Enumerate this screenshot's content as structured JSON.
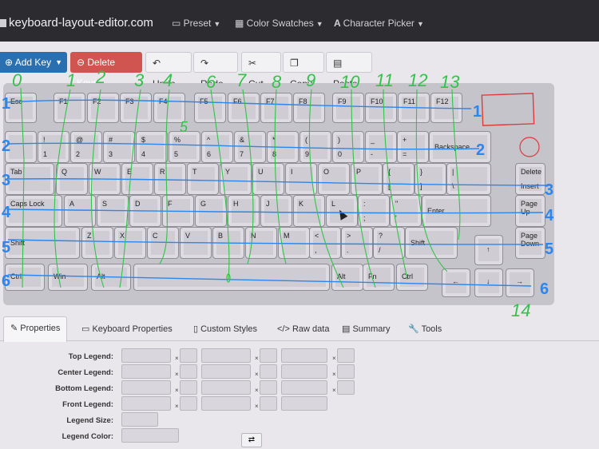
{
  "nav": {
    "brand": "keyboard-layout-editor.com",
    "menus": [
      {
        "label": "Preset",
        "icon": "keyboard-icon"
      },
      {
        "label": "Color Swatches",
        "icon": "grid-icon"
      },
      {
        "label": "Character Picker",
        "icon": "font-icon"
      }
    ]
  },
  "toolbar": {
    "add_key": "Add Key",
    "delete_keys": "Delete Keys",
    "undo": "Undo",
    "redo": "Redo",
    "cut": "Cut",
    "copy": "Copy",
    "paste": "Paste"
  },
  "keys": {
    "esc": "Esc",
    "f1": "F1",
    "f2": "F2",
    "f3": "F3",
    "f4": "F4",
    "f5": "F5",
    "f6": "F6",
    "f7": "F7",
    "f8": "F8",
    "f9": "F9",
    "f10": "F10",
    "f11": "F11",
    "f12": "F12",
    "n1t": "!",
    "n1b": "1",
    "n2t": "@",
    "n2b": "2",
    "n3t": "#",
    "n3b": "3",
    "n4t": "$",
    "n4b": "4",
    "n5t": "%",
    "n5b": "5",
    "n6t": "^",
    "n6b": "6",
    "n7t": "&",
    "n7b": "7",
    "n8t": "*",
    "n8b": "8",
    "n9t": "(",
    "n9b": "9",
    "n0t": ")",
    "n0b": "0",
    "mint": "_",
    "minb": "-",
    "eqt": "+",
    "eqb": "=",
    "backspace": "Backspace",
    "tab": "Tab",
    "q": "Q",
    "w": "W",
    "e": "E",
    "r": "R",
    "t": "T",
    "y": "Y",
    "u": "U",
    "i": "I",
    "o": "O",
    "p": "P",
    "lbt": "{",
    "lbb": "[",
    "rbt": "}",
    "rbb": "]",
    "bst": "|",
    "bsb": "\\",
    "delete": "Delete",
    "insert": "Insert",
    "caps": "Caps Lock",
    "a": "A",
    "s": "S",
    "d": "D",
    "f": "F",
    "g": "G",
    "h": "H",
    "j": "J",
    "k": "K",
    "l": "L",
    "sct": ":",
    "scb": ";",
    "qtt": "\"",
    "qtb": "'",
    "enter": "Enter",
    "pgup": "Page\nUp",
    "lshift": "Shift",
    "z": "Z",
    "x": "X",
    "c": "C",
    "v": "V",
    "b": "B",
    "n": "N",
    "m": "M",
    "cmt": "<",
    "cmb": ",",
    "pdt": ">",
    "pdb": ".",
    "slt": "?",
    "slb": "/",
    "rshift": "Shift",
    "up": "↑",
    "pgdn": "Page\nDown",
    "ctrl": "Ctrl",
    "win": "Win",
    "alt": "Alt",
    "ralt": "Alt",
    "fn": "Fn",
    "rctrl": "Ctrl",
    "left": "←",
    "down": "↓",
    "right": "→"
  },
  "tabs": [
    {
      "label": "Properties",
      "icon": "edit-icon"
    },
    {
      "label": "Keyboard Properties",
      "icon": "keyboard-icon"
    },
    {
      "label": "Custom Styles",
      "icon": "file-icon"
    },
    {
      "label": "Raw data",
      "icon": "code-icon"
    },
    {
      "label": "Summary",
      "icon": "list-icon"
    },
    {
      "label": "Tools",
      "icon": "wrench-icon"
    }
  ],
  "properties": {
    "top_legend": "Top Legend:",
    "center_legend": "Center Legend:",
    "bottom_legend": "Bottom Legend:",
    "front_legend": "Front Legend:",
    "legend_size": "Legend Size:",
    "legend_color": "Legend Color:"
  },
  "annotations": {
    "columns": [
      "0",
      "1",
      "2",
      "3",
      "4",
      "5",
      "6",
      "7",
      "8",
      "9",
      "10",
      "11",
      "12",
      "13",
      "14"
    ],
    "rows": [
      "1",
      "2",
      "3",
      "4",
      "5",
      "6"
    ],
    "rows_right": [
      "1",
      "2",
      "3",
      "4",
      "5",
      "6"
    ]
  },
  "colors": {
    "ink_green": "#33c24a",
    "ink_blue": "#2a86f0",
    "ink_red": "#e03a3a"
  }
}
